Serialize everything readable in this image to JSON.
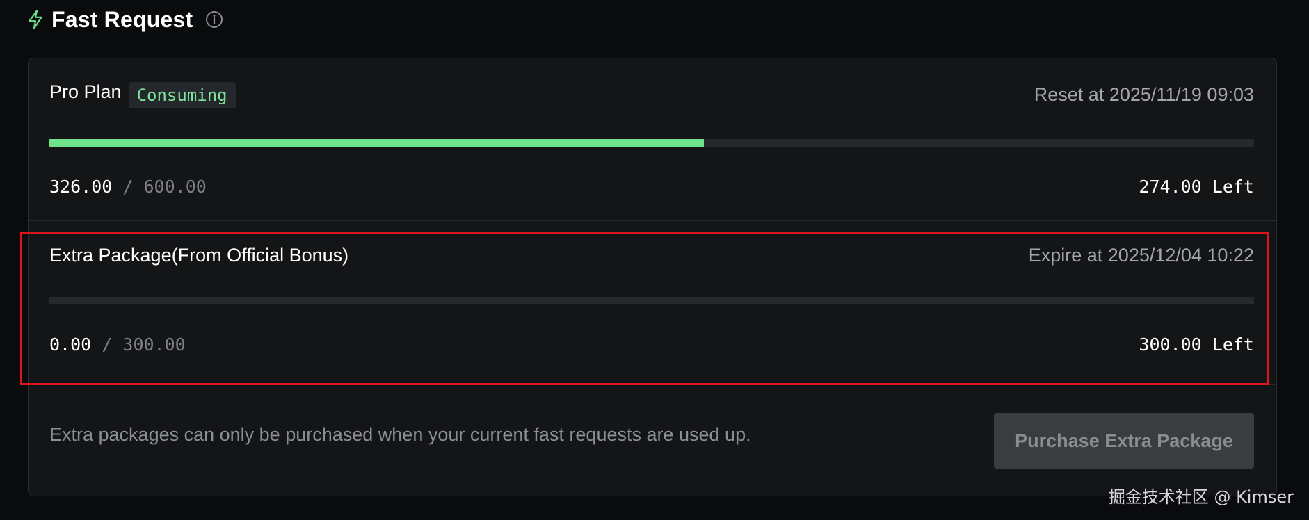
{
  "header": {
    "title": "Fast Request",
    "icon": "bolt-icon",
    "info_icon": "info-icon"
  },
  "plans": [
    {
      "name": "Pro Plan",
      "badge": "Consuming",
      "meta": "Reset at 2025/11/19 09:03",
      "used": "326.00",
      "separator": "/",
      "total": "600.00",
      "left": "274.00 Left",
      "progress_fraction": 0.5433
    },
    {
      "name": "Extra Package(From Official Bonus)",
      "badge": "",
      "meta": "Expire at 2025/12/04 10:22",
      "used": "0.00",
      "separator": "/",
      "total": "300.00",
      "left": "300.00 Left",
      "progress_fraction": 0
    }
  ],
  "footer": {
    "note": "Extra packages can only be purchased when your current fast requests are used up.",
    "purchase_label": "Purchase Extra Package",
    "purchase_disabled": true
  },
  "watermark": "掘金技术社区 @ Kimser",
  "colors": {
    "accent_green": "#6fe38c",
    "badge_text": "#7ee69a",
    "highlight_red": "#e0141e",
    "card_bg": "#141517",
    "page_bg": "#0a0b0d"
  }
}
